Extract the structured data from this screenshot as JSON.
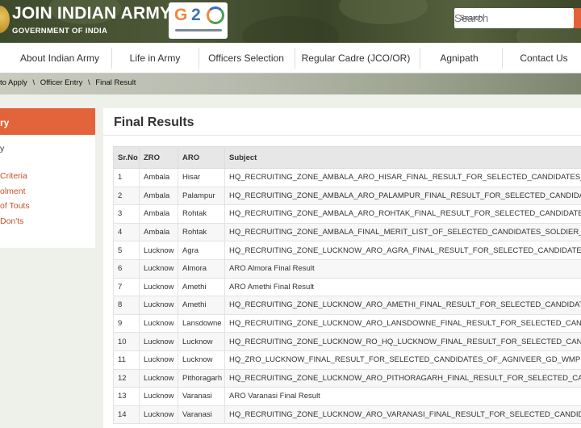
{
  "header": {
    "title": "JOIN INDIAN ARMY",
    "subtitle": "GOVERNMENT OF INDIA",
    "g20_logo": "G20",
    "search_placeholder": "Search"
  },
  "nav": {
    "items": [
      {
        "label": "About Indian Army"
      },
      {
        "label": "Life in Army"
      },
      {
        "label": "Officers Selection"
      },
      {
        "label": "Regular Cadre (JCO/OR)"
      },
      {
        "label": "Agnipath"
      },
      {
        "label": "Contact Us"
      }
    ]
  },
  "breadcrumb": {
    "items": [
      "to Apply",
      "\\",
      "Officer Entry",
      "\\",
      "Final Result"
    ]
  },
  "sidebar": {
    "heading": "ry",
    "links": [
      "y",
      "Criteria",
      "olment",
      "of Touts",
      "Don'ts"
    ]
  },
  "main": {
    "title": "Final Results",
    "columns": [
      "Sr.No",
      "ZRO",
      "ARO",
      "Subject"
    ],
    "rows": [
      [
        "1",
        "Ambala",
        "Hisar",
        "HQ_RECRUITING_ZONE_AMBALA_ARO_HISAR_FINAL_RESULT_FOR_SELECTED_CANDIDATES_OF_AG"
      ],
      [
        "2",
        "Ambala",
        "Palampur",
        "HQ_RECRUITING_ZONE_AMBALA_ARO_PALAMPUR_FINAL_RESULT_FOR_SELECTED_CANDIDATES_O"
      ],
      [
        "3",
        "Ambala",
        "Rohtak",
        "HQ_RECRUITING_ZONE_AMBALA_ARO_ROHTAK_FINAL_RESULT_FOR_SELECTED_CANDIDATES_OF_A"
      ],
      [
        "4",
        "Ambala",
        "Rohtak",
        "HQ_RECRUITING_ZONE_AMBALA_FINAL_MERIT_LIST_OF_SELECTED_CANDIDATES_SOLDIER_TECHN"
      ],
      [
        "5",
        "Lucknow",
        "Agra",
        "HQ_RECRUITING_ZONE_LUCKNOW_ARO_AGRA_FINAL_RESULT_FOR_SELECTED_CANDIDATES_OF_A"
      ],
      [
        "6",
        "Lucknow",
        "Almora",
        "ARO Almora Final Result"
      ],
      [
        "7",
        "Lucknow",
        "Amethi",
        "ARO Amethi Final Result"
      ],
      [
        "8",
        "Lucknow",
        "Amethi",
        "HQ_RECRUITING_ZONE_LUCKNOW_ARO_AMETHI_FINAL_RESULT_FOR_SELECTED_CANDIDATES_AG"
      ],
      [
        "9",
        "Lucknow",
        "Lansdowne",
        "HQ_RECRUITING_ZONE_LUCKNOW_ARO_LANSDOWNE_FINAL_RESULT_FOR_SELECTED_CANDIDATE"
      ],
      [
        "10",
        "Lucknow",
        "Lucknow",
        "HQ_RECRUITING_ZONE_LUCKNOW_RO_HQ_LUCKNOW_FINAL_RESULT_FOR_SELECTED_CANDIDATE"
      ],
      [
        "11",
        "Lucknow",
        "Lucknow",
        "HQ_ZRO_LUCKNOW_FINAL_RESULT_FOR_SELECTED_CANDIDATES_OF_AGNIVEER_GD_WMP"
      ],
      [
        "12",
        "Lucknow",
        "Pithoragarh",
        "HQ_RECRUITING_ZONE_LUCKNOW_ARO_PITHORAGARH_FINAL_RESULT_FOR_SELECTED_CANDIDAT"
      ],
      [
        "13",
        "Lucknow",
        "Varanasi",
        "ARO Varanasi Final Result"
      ],
      [
        "14",
        "Lucknow",
        "Varanasi",
        "HQ_RECRUITING_ZONE_LUCKNOW_ARO_VARANASI_FINAL_RESULT_FOR_SELECTED_CANDIDATES_"
      ]
    ]
  },
  "colors": {
    "accent": "#e3643a",
    "header_bg": "#4a5434",
    "link": "#c5512b"
  }
}
